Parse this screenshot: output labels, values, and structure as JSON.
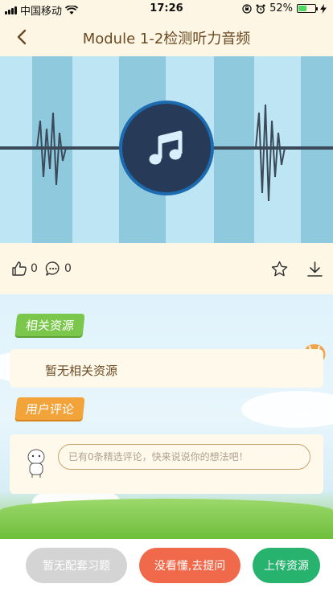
{
  "status_bar": {
    "carrier": "中国移动",
    "time": "17:26",
    "battery": "52%",
    "battery_level": 0.52,
    "icons": [
      "signal-icon",
      "wifi-icon",
      "orientation-lock-icon",
      "alarm-icon",
      "battery-icon",
      "charging-icon"
    ]
  },
  "nav": {
    "title": "Module 1-2检测听力音频",
    "back_icon": "chevron-left-icon"
  },
  "player": {
    "icon": "music-note-icon",
    "colors": {
      "bg": "#bde5f3",
      "stripe": "#8fc9dd",
      "disc": "#273a57",
      "disc_border": "#1c6bb0"
    }
  },
  "actions": {
    "like_count": "0",
    "comment_count": "0",
    "icons": [
      "thumb-up-icon",
      "comment-icon",
      "star-icon",
      "download-icon"
    ]
  },
  "related": {
    "tag": "相关资源",
    "empty_text": "暂无相关资源"
  },
  "comments": {
    "tag": "用户评论",
    "placeholder": "已有0条精选评论，快来说说你的想法吧！"
  },
  "buttons": {
    "no_exercise": "暂无配套习题",
    "ask": "没看懂,去提问",
    "upload": "上传资源"
  },
  "colors": {
    "accent_brown": "#6b4a23",
    "green": "#27b26e",
    "red": "#f0694a",
    "gray": "#d4d4d4",
    "tag_green": "#7bc74b",
    "tag_orange": "#f2a33a"
  }
}
